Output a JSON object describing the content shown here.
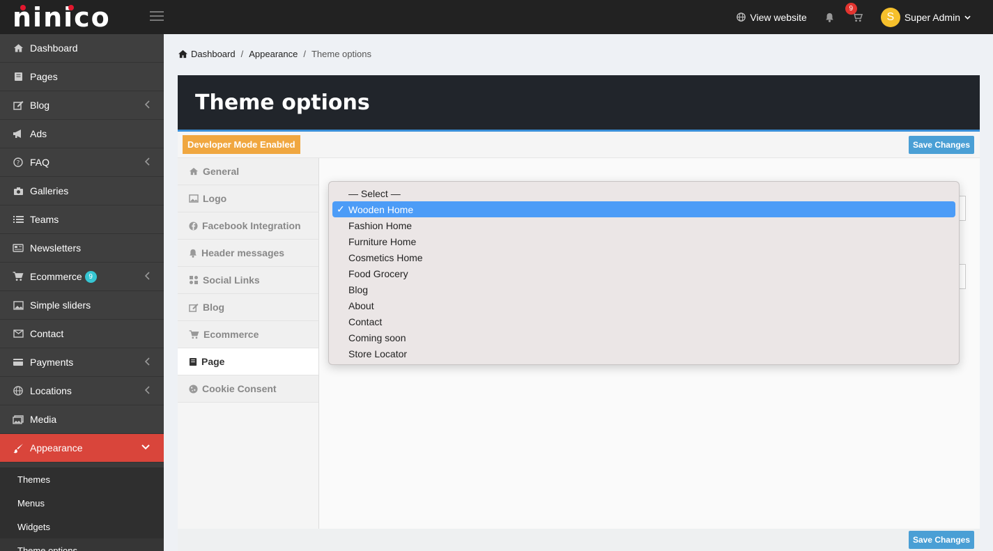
{
  "brand": {
    "name": "ninico"
  },
  "topbar": {
    "view_website": "View website",
    "cart_count": "9",
    "user_initial": "S",
    "user_name": "Super Admin"
  },
  "sidebar": {
    "items": [
      {
        "label": "Dashboard",
        "icon": "home-icon"
      },
      {
        "label": "Pages",
        "icon": "book-icon"
      },
      {
        "label": "Blog",
        "icon": "edit-icon",
        "has_children": true
      },
      {
        "label": "Ads",
        "icon": "bullhorn-icon"
      },
      {
        "label": "FAQ",
        "icon": "question-circle-icon",
        "has_children": true
      },
      {
        "label": "Galleries",
        "icon": "camera-icon"
      },
      {
        "label": "Teams",
        "icon": "list-icon"
      },
      {
        "label": "Newsletters",
        "icon": "newspaper-icon"
      },
      {
        "label": "Ecommerce",
        "icon": "cart-icon",
        "badge": "9",
        "has_children": true
      },
      {
        "label": "Simple sliders",
        "icon": "image-icon"
      },
      {
        "label": "Contact",
        "icon": "envelope-icon"
      },
      {
        "label": "Payments",
        "icon": "credit-card-icon",
        "has_children": true
      },
      {
        "label": "Locations",
        "icon": "globe-icon",
        "has_children": true
      },
      {
        "label": "Media",
        "icon": "images-icon"
      },
      {
        "label": "Appearance",
        "icon": "paint-brush-icon",
        "active": true
      }
    ],
    "sub_items": [
      {
        "label": "Themes"
      },
      {
        "label": "Menus"
      },
      {
        "label": "Widgets"
      },
      {
        "label": "Theme options"
      }
    ]
  },
  "breadcrumb": {
    "home": "Dashboard",
    "parent": "Appearance",
    "current": "Theme options"
  },
  "page": {
    "title": "Theme options",
    "dev_mode": "Developer Mode Enabled",
    "save_label": "Save Changes"
  },
  "tabs": [
    {
      "label": "General",
      "icon": "home-icon"
    },
    {
      "label": "Logo",
      "icon": "image-icon"
    },
    {
      "label": "Facebook Integration",
      "icon": "facebook-icon"
    },
    {
      "label": "Header messages",
      "icon": "bell-icon"
    },
    {
      "label": "Social Links",
      "icon": "share-icon"
    },
    {
      "label": "Blog",
      "icon": "edit-icon"
    },
    {
      "label": "Ecommerce",
      "icon": "cart-icon"
    },
    {
      "label": "Page",
      "icon": "book-icon",
      "active": true
    },
    {
      "label": "Cookie Consent",
      "icon": "cookie-icon"
    }
  ],
  "dropdown": {
    "options": [
      {
        "label": "— Select —"
      },
      {
        "label": "Wooden Home",
        "selected": true
      },
      {
        "label": "Fashion Home"
      },
      {
        "label": "Furniture Home"
      },
      {
        "label": "Cosmetics Home"
      },
      {
        "label": "Food Grocery"
      },
      {
        "label": "Blog"
      },
      {
        "label": "About"
      },
      {
        "label": "Contact"
      },
      {
        "label": "Coming soon"
      },
      {
        "label": "Store Locator"
      }
    ]
  },
  "colors": {
    "active_nav": "#d9453b",
    "header_dark": "#21252b",
    "accent_blue": "#4a9fd5",
    "dev_badge": "#f0a740"
  }
}
